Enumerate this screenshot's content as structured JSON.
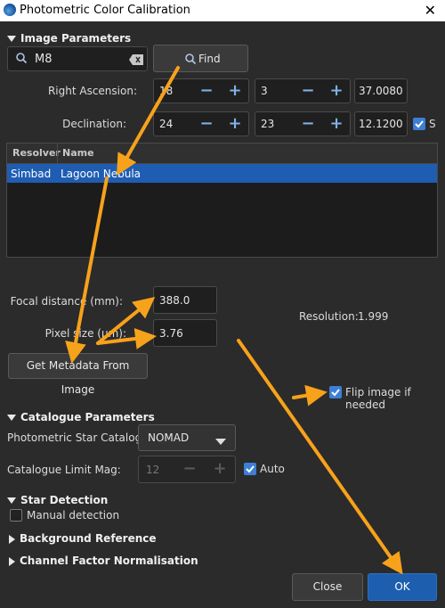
{
  "window": {
    "title": "Photometric Color Calibration",
    "close_glyph": "✕"
  },
  "image_parameters": {
    "section_label": "Image Parameters",
    "object_name": "M8",
    "find_label": "Find",
    "ra": {
      "label": "Right Ascension:",
      "h": "18",
      "m": "3",
      "s": "37.0080"
    },
    "dec": {
      "label": "Declination:",
      "d": "24",
      "m": "23",
      "s": "12.1200",
      "south_label": "S",
      "south_checked": true
    },
    "resolver_table": {
      "columns": [
        "Resolver",
        "Name"
      ],
      "rows": [
        {
          "resolver": "Simbad",
          "name": "Lagoon Nebula",
          "selected": true
        }
      ]
    },
    "focal": {
      "label": "Focal distance (mm):",
      "value": "388.0"
    },
    "pixel": {
      "label": "Pixel size (µm):",
      "value": "3.76"
    },
    "resolution": {
      "label": "Resolution:",
      "value": "1.999"
    },
    "metadata_button": "Get Metadata From Image",
    "flip": {
      "label": "Flip image if needed",
      "checked": true
    }
  },
  "catalogue": {
    "section_label": "Catalogue Parameters",
    "star_catalogue": {
      "label": "Photometric Star Catalogue:",
      "value": "NOMAD"
    },
    "limit_mag": {
      "label": "Catalogue Limit Mag:",
      "value": "12",
      "auto_label": "Auto",
      "auto_checked": true
    }
  },
  "star_detection": {
    "section_label": "Star Detection",
    "manual_label": "Manual detection",
    "manual_checked": false
  },
  "background_reference": {
    "section_label": "Background Reference"
  },
  "channel_factor": {
    "section_label": "Channel Factor Normalisation"
  },
  "buttons": {
    "close": "Close",
    "ok": "OK"
  },
  "colors": {
    "accent": "#3d7fd6",
    "selection": "#1f5db3",
    "ok_button": "#1d5fae",
    "annotation_arrow": "#f7a21b"
  },
  "icons": [
    "app-icon",
    "search-icon",
    "clear-icon",
    "chevron-down-icon",
    "minus-icon",
    "plus-icon",
    "checkmark-icon"
  ]
}
